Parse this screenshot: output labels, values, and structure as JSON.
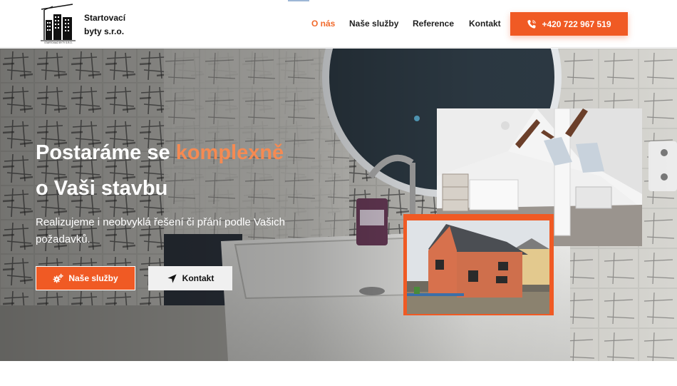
{
  "header": {
    "brand_line1": "Startovací",
    "brand_line2": "byty s.r.o.",
    "logo_caption": "STARTOVACÍ BYTY S.R.O."
  },
  "nav": {
    "items": [
      {
        "label": "O nás",
        "active": true
      },
      {
        "label": "Naše služby",
        "active": false
      },
      {
        "label": "Reference",
        "active": false
      },
      {
        "label": "Kontakt",
        "active": false
      }
    ],
    "phone": "+420 722 967 519",
    "phone_icon": "phone-icon"
  },
  "hero": {
    "headline_part1": "Postaráme se",
    "headline_accent": "komplexně",
    "headline_line2": "o Vaši stavbu",
    "subtext": "Realizujeme i neobvyklá řešení či přání podle Vašich požadavků.",
    "btn_services": "Naše služby",
    "btn_services_icon": "gears-icon",
    "btn_contact": "Kontakt",
    "btn_contact_icon": "location-arrow-icon"
  },
  "colors": {
    "accent": "#f05a24",
    "accent_text": "#f58a52",
    "nav_active": "#f16a2c"
  }
}
